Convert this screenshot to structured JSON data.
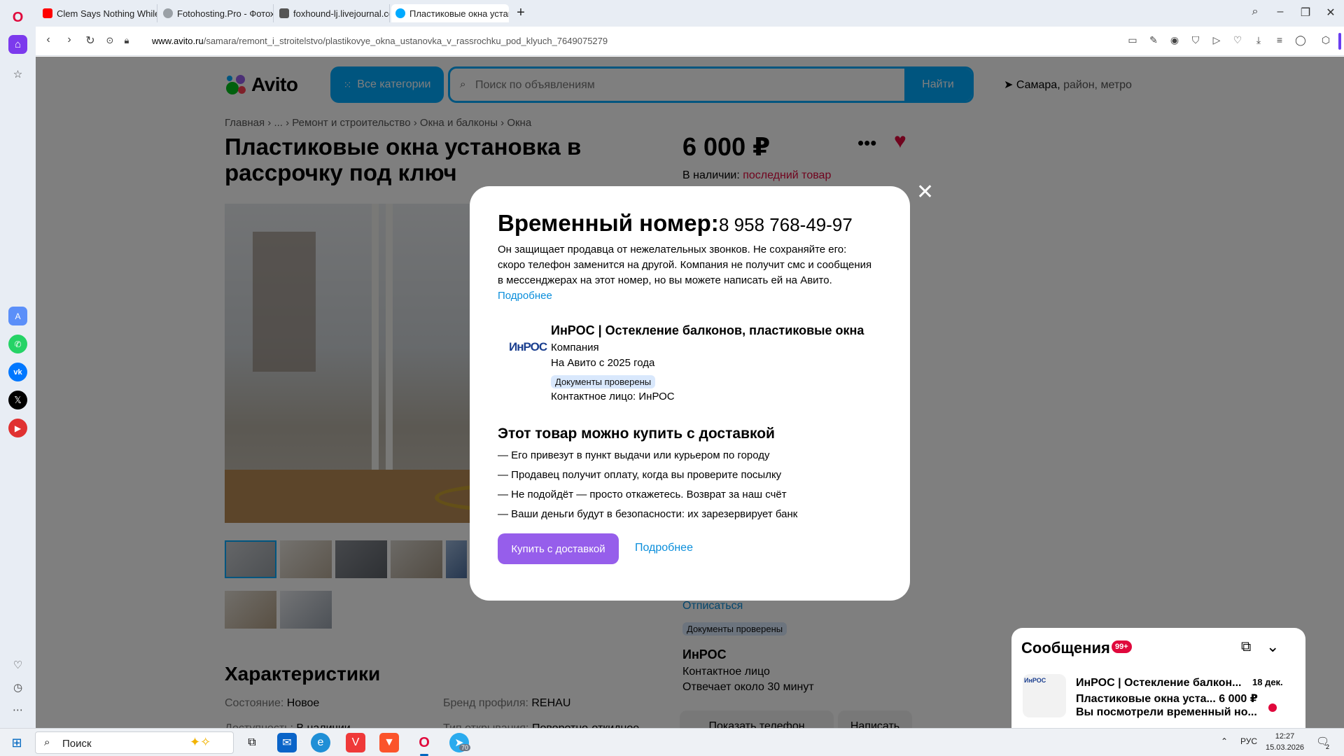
{
  "browser": {
    "tabs": [
      {
        "title": "Clem Says Nothing While",
        "favicon_color": "#ff0000"
      },
      {
        "title": "Fotohosting.Pro - Фотохо",
        "favicon_color": "#9aa0a6"
      },
      {
        "title": "foxhound-lj.livejournal.co",
        "favicon_color": "#555555"
      },
      {
        "title": "Пластиковые окна устано",
        "favicon_color": "#00aaff"
      }
    ],
    "url_host": "www.avito.ru",
    "url_path": "/samara/remont_i_stroitelstvo/plastikovye_okna_ustanovka_v_rassrochku_pod_klyuch_7649075279"
  },
  "header": {
    "logo_text": "Avito",
    "categories_label": "Все категории",
    "search_placeholder": "Поиск по объявлениям",
    "search_button": "Найти",
    "city": "Самара,",
    "city_sub": " район, метро"
  },
  "breadcrumb": [
    "Главная",
    "...",
    "Ремонт и строительство",
    "Окна и балконы",
    "Окна"
  ],
  "listing": {
    "title": "Пластиковые окна установка в рассрочку под ключ",
    "price": "6 000 ₽",
    "stock_label": "В наличии:",
    "stock_value": "последний товар"
  },
  "seller": {
    "unsubscribe": "Отписаться",
    "docs_badge": "Документы проверены",
    "name": "ИнРОС",
    "role": "Контактное лицо",
    "response": "Отвечает около 30 минут",
    "show_phone": "Показать телефон",
    "write": "Написать"
  },
  "characteristics": {
    "title": "Характеристики",
    "rows": [
      {
        "key": "Состояние:",
        "value": "Новое"
      },
      {
        "key": "Бренд профиля:",
        "value": "REHAU"
      },
      {
        "key": "Доступность:",
        "value": "В наличии"
      },
      {
        "key": "Тип открывания:",
        "value": "Поворотно-откидное"
      }
    ]
  },
  "messages": {
    "title": "Сообщения",
    "count": "99+",
    "item": {
      "name": "ИнРОС | Остекление балкон...",
      "date": "18 дек.",
      "line2": "Пластиковые окна уста... 6 000 ₽",
      "line3": "Вы посмотрели временный но..."
    }
  },
  "modal": {
    "title": "Временный номер:",
    "number": "8 958 768-49-97",
    "desc": "Он защищает продавца от нежелательных звонков. Не сохраняйте его: скоро телефон заменится на другой. Компания не получит смс и сообщения в мессенджерах на этот номер, но вы можете написать ей на Авито.",
    "desc_link": "Подробнее",
    "company_name": "ИнРОС | Остекление балконов, пластиковые окна",
    "company_type": "Компания",
    "company_since": "На Авито с 2025 года",
    "company_badge": "Документы проверены",
    "company_contact": "Контактное лицо: ИнРОС",
    "logo_text": "ИнРОС",
    "delivery_title": "Этот товар можно купить с доставкой",
    "delivery_items": [
      "—  Его привезут в пункт выдачи или курьером по городу",
      "—  Продавец получит оплату, когда вы проверите посылку",
      "—  Не подойдёт — просто откажетесь. Возврат за наш счёт",
      "—  Ваши деньги будут в безопасности: их зарезервирует банк"
    ],
    "buy_button": "Купить с доставкой",
    "more_link": "Подробнее"
  },
  "taskbar": {
    "search_label": "Поиск",
    "lang": "РУС",
    "time": "12:27",
    "date": "15.03.2026",
    "notif_count": "2",
    "telegram_badge": "70"
  },
  "colors": {
    "avito_blue": "#00aaff",
    "buy_purple": "#965eeb",
    "link_blue": "#0a8edb",
    "alert_red": "#e0083c"
  }
}
